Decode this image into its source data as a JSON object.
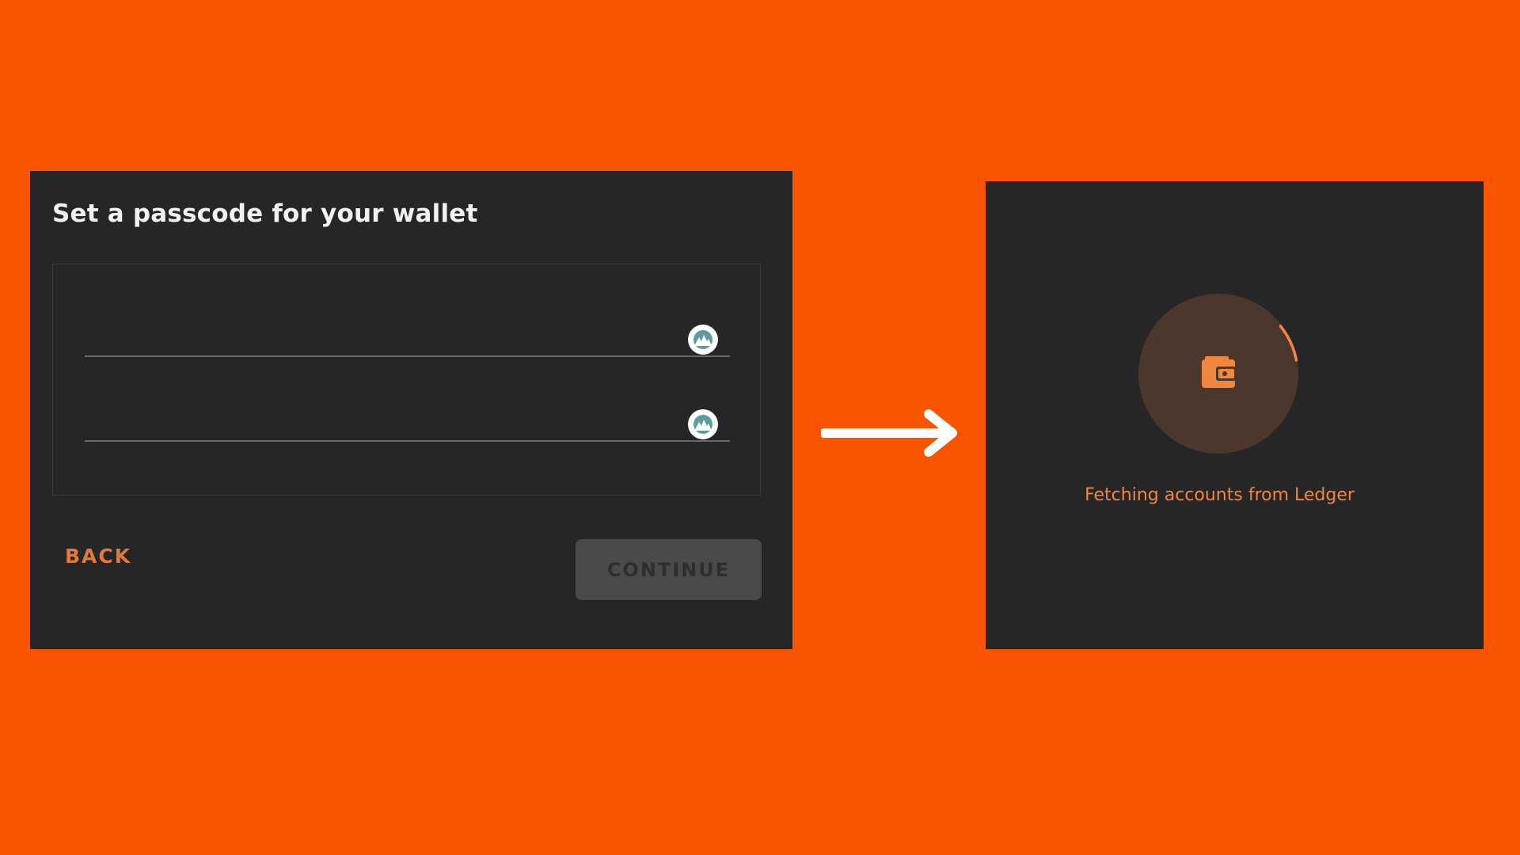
{
  "passcode_screen": {
    "title": "Set a passcode for your wallet",
    "fields": [
      {
        "value": "",
        "icon": "visibility-toggle-icon"
      },
      {
        "value": "",
        "icon": "visibility-toggle-icon"
      }
    ],
    "back_label": "BACK",
    "continue_label": "CONTINUE"
  },
  "transition": {
    "icon": "right-arrow-icon"
  },
  "loading_screen": {
    "icon": "wallet-icon",
    "status": "Fetching accounts from Ledger"
  },
  "colors": {
    "background": "#FA5400",
    "panel": "#262628",
    "accent": "#E07A3A",
    "loader_circle": "#4B372B",
    "disabled_button": "#4A4A4C"
  }
}
